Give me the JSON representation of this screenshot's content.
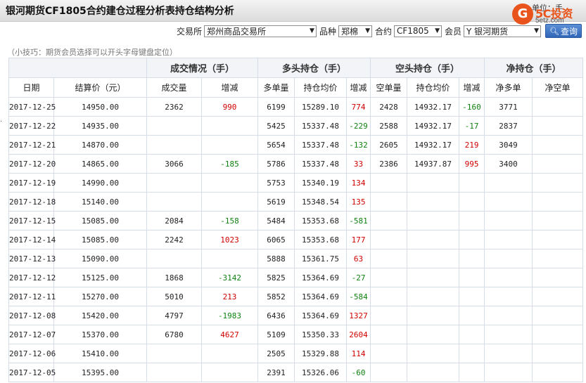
{
  "header": {
    "title": "银河期货CF1805合约建仓过程分析表持仓结构分析",
    "unit_label": "单位：手"
  },
  "logo": {
    "mark": "G",
    "brand": "5C投资",
    "url": "5etz.com"
  },
  "filters": {
    "exchange_label": "交易所",
    "exchange_value": "郑州商品交易所",
    "variety_label": "品种",
    "variety_value": "郑棉",
    "contract_label": "合约",
    "contract_value": "CF1805",
    "member_label": "会员",
    "member_value": "Y 银河期货",
    "query_label": "查询"
  },
  "tip": "（小技巧：期货会员选择可以开头字母键盘定位）",
  "side_mark": "·",
  "table": {
    "groups": {
      "volume": "成交情况（手）",
      "long": "多头持仓（手）",
      "short": "空头持仓（手）",
      "net": "净持仓（手）"
    },
    "columns": {
      "date": "日期",
      "settle": "结算价（元）",
      "volume": "成交量",
      "volume_chg": "增减",
      "long_qty": "多单量",
      "long_avg": "持仓均价",
      "long_chg": "增减",
      "short_qty": "空单量",
      "short_avg": "持仓均价",
      "short_chg": "增减",
      "net_long": "净多单",
      "net_short": "净空单"
    },
    "rows": [
      {
        "date": "2017-12-25",
        "settle": "14950.00",
        "volume": "2362",
        "volume_chg": "990",
        "long_qty": "6199",
        "long_avg": "15289.10",
        "long_chg": "774",
        "short_qty": "2428",
        "short_avg": "14932.17",
        "short_chg": "-160",
        "net_long": "3771",
        "net_short": ""
      },
      {
        "date": "2017-12-22",
        "settle": "14935.00",
        "volume": "",
        "volume_chg": "",
        "long_qty": "5425",
        "long_avg": "15337.48",
        "long_chg": "-229",
        "short_qty": "2588",
        "short_avg": "14932.17",
        "short_chg": "-17",
        "net_long": "2837",
        "net_short": ""
      },
      {
        "date": "2017-12-21",
        "settle": "14870.00",
        "volume": "",
        "volume_chg": "",
        "long_qty": "5654",
        "long_avg": "15337.48",
        "long_chg": "-132",
        "short_qty": "2605",
        "short_avg": "14932.17",
        "short_chg": "219",
        "net_long": "3049",
        "net_short": ""
      },
      {
        "date": "2017-12-20",
        "settle": "14865.00",
        "volume": "3066",
        "volume_chg": "-185",
        "long_qty": "5786",
        "long_avg": "15337.48",
        "long_chg": "33",
        "short_qty": "2386",
        "short_avg": "14937.87",
        "short_chg": "995",
        "net_long": "3400",
        "net_short": ""
      },
      {
        "date": "2017-12-19",
        "settle": "14990.00",
        "volume": "",
        "volume_chg": "",
        "long_qty": "5753",
        "long_avg": "15340.19",
        "long_chg": "134",
        "short_qty": "",
        "short_avg": "",
        "short_chg": "",
        "net_long": "",
        "net_short": ""
      },
      {
        "date": "2017-12-18",
        "settle": "15140.00",
        "volume": "",
        "volume_chg": "",
        "long_qty": "5619",
        "long_avg": "15348.54",
        "long_chg": "135",
        "short_qty": "",
        "short_avg": "",
        "short_chg": "",
        "net_long": "",
        "net_short": ""
      },
      {
        "date": "2017-12-15",
        "settle": "15085.00",
        "volume": "2084",
        "volume_chg": "-158",
        "long_qty": "5484",
        "long_avg": "15353.68",
        "long_chg": "-581",
        "short_qty": "",
        "short_avg": "",
        "short_chg": "",
        "net_long": "",
        "net_short": ""
      },
      {
        "date": "2017-12-14",
        "settle": "15085.00",
        "volume": "2242",
        "volume_chg": "1023",
        "long_qty": "6065",
        "long_avg": "15353.68",
        "long_chg": "177",
        "short_qty": "",
        "short_avg": "",
        "short_chg": "",
        "net_long": "",
        "net_short": ""
      },
      {
        "date": "2017-12-13",
        "settle": "15090.00",
        "volume": "",
        "volume_chg": "",
        "long_qty": "5888",
        "long_avg": "15361.75",
        "long_chg": "63",
        "short_qty": "",
        "short_avg": "",
        "short_chg": "",
        "net_long": "",
        "net_short": ""
      },
      {
        "date": "2017-12-12",
        "settle": "15125.00",
        "volume": "1868",
        "volume_chg": "-3142",
        "long_qty": "5825",
        "long_avg": "15364.69",
        "long_chg": "-27",
        "short_qty": "",
        "short_avg": "",
        "short_chg": "",
        "net_long": "",
        "net_short": ""
      },
      {
        "date": "2017-12-11",
        "settle": "15270.00",
        "volume": "5010",
        "volume_chg": "213",
        "long_qty": "5852",
        "long_avg": "15364.69",
        "long_chg": "-584",
        "short_qty": "",
        "short_avg": "",
        "short_chg": "",
        "net_long": "",
        "net_short": ""
      },
      {
        "date": "2017-12-08",
        "settle": "15420.00",
        "volume": "4797",
        "volume_chg": "-1983",
        "long_qty": "6436",
        "long_avg": "15364.69",
        "long_chg": "1327",
        "short_qty": "",
        "short_avg": "",
        "short_chg": "",
        "net_long": "",
        "net_short": ""
      },
      {
        "date": "2017-12-07",
        "settle": "15370.00",
        "volume": "6780",
        "volume_chg": "4627",
        "long_qty": "5109",
        "long_avg": "15350.33",
        "long_chg": "2604",
        "short_qty": "",
        "short_avg": "",
        "short_chg": "",
        "net_long": "",
        "net_short": ""
      },
      {
        "date": "2017-12-06",
        "settle": "15410.00",
        "volume": "",
        "volume_chg": "",
        "long_qty": "2505",
        "long_avg": "15329.88",
        "long_chg": "114",
        "short_qty": "",
        "short_avg": "",
        "short_chg": "",
        "net_long": "",
        "net_short": ""
      },
      {
        "date": "2017-12-05",
        "settle": "15395.00",
        "volume": "",
        "volume_chg": "",
        "long_qty": "2391",
        "long_avg": "15326.06",
        "long_chg": "-60",
        "short_qty": "",
        "short_avg": "",
        "short_chg": "",
        "net_long": "",
        "net_short": ""
      }
    ]
  },
  "colors": {
    "increase": "#d00000",
    "decrease": "#108010",
    "brand": "#e8541b"
  }
}
